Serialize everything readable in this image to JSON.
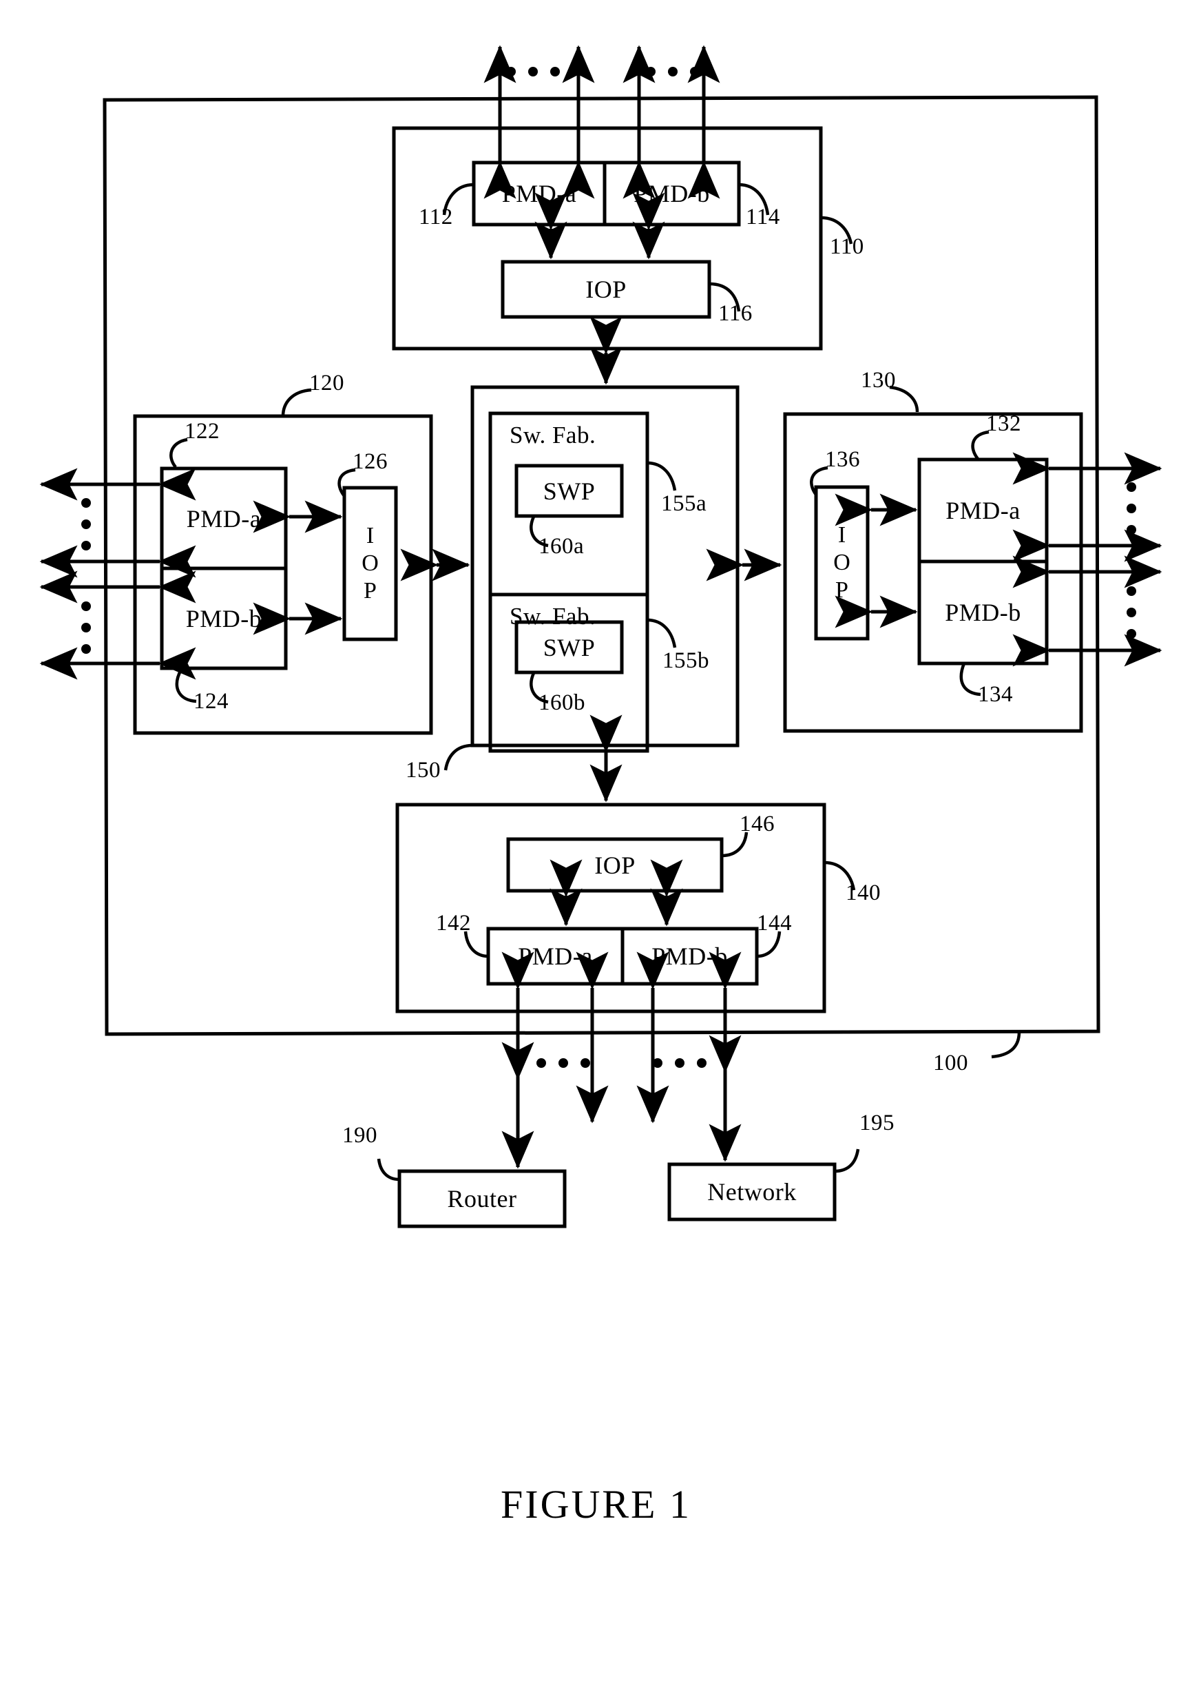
{
  "figure": {
    "title": "FIGURE 1",
    "system_ref": "100"
  },
  "modules": {
    "top": {
      "ref": "110",
      "pmd_a": {
        "label": "PMD-a",
        "ref": "112"
      },
      "pmd_b": {
        "label": "PMD-b",
        "ref": "114"
      },
      "iop": {
        "label": "IOP",
        "ref": "116"
      }
    },
    "left": {
      "ref": "120",
      "pmd_a": {
        "label": "PMD-a",
        "ref": "122"
      },
      "pmd_b": {
        "label": "PMD-b",
        "ref": "124"
      },
      "iop": {
        "label": "I\nO\nP",
        "letters": [
          "I",
          "O",
          "P"
        ],
        "ref": "126"
      }
    },
    "right": {
      "ref": "130",
      "pmd_a": {
        "label": "PMD-a",
        "ref": "132"
      },
      "pmd_b": {
        "label": "PMD-b",
        "ref": "134"
      },
      "iop": {
        "label": "I\nO\nP",
        "letters": [
          "I",
          "O",
          "P"
        ],
        "ref": "136"
      }
    },
    "bottom": {
      "ref": "140",
      "pmd_a": {
        "label": "PMD-a",
        "ref": "142"
      },
      "pmd_b": {
        "label": "PMD-b",
        "ref": "144"
      },
      "iop": {
        "label": "IOP",
        "ref": "146"
      }
    },
    "center": {
      "ref": "150",
      "fabric_a": {
        "label": "Sw. Fab.",
        "ref": "155a",
        "swp": {
          "label": "SWP",
          "ref": "160a"
        }
      },
      "fabric_b": {
        "label": "Sw. Fab.",
        "ref": "155b",
        "swp": {
          "label": "SWP",
          "ref": "160b"
        }
      }
    }
  },
  "external": {
    "router": {
      "label": "Router",
      "ref": "190"
    },
    "network": {
      "label": "Network",
      "ref": "195"
    }
  },
  "style": {
    "line_color": "#000000",
    "background": "#ffffff"
  }
}
